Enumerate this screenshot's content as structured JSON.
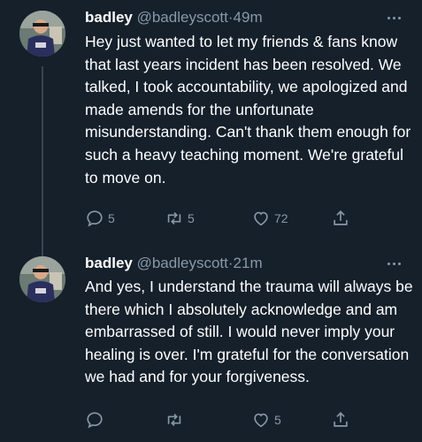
{
  "tweets": [
    {
      "name": "badley",
      "handle": "@badleyscott",
      "dot": "·",
      "time": "49m",
      "text": "Hey just wanted to let my friends & fans know that last years incident has been resolved. We talked, I took accountability, we apologized and made amends for the unfortunate misunderstanding. Can't thank them enough for such a heavy teaching moment. We're grateful to move on.",
      "replies": "5",
      "retweets": "5",
      "likes": "72"
    },
    {
      "name": "badley",
      "handle": "@badleyscott",
      "dot": "·",
      "time": "21m",
      "text": "And yes, I understand the trauma will always be there which I absolutely acknowledge and am embarrassed of still. I would never imply your healing is over. I'm grateful for the conversation we had and for your forgiveness.",
      "replies": "",
      "retweets": "",
      "likes": "5"
    }
  ],
  "icons": [
    "reply-icon",
    "retweet-icon",
    "like-icon",
    "share-icon",
    "more-icon"
  ],
  "colors": {
    "background": "#15202b",
    "secondary_text": "#8899a6",
    "thread_line": "#38444d"
  }
}
